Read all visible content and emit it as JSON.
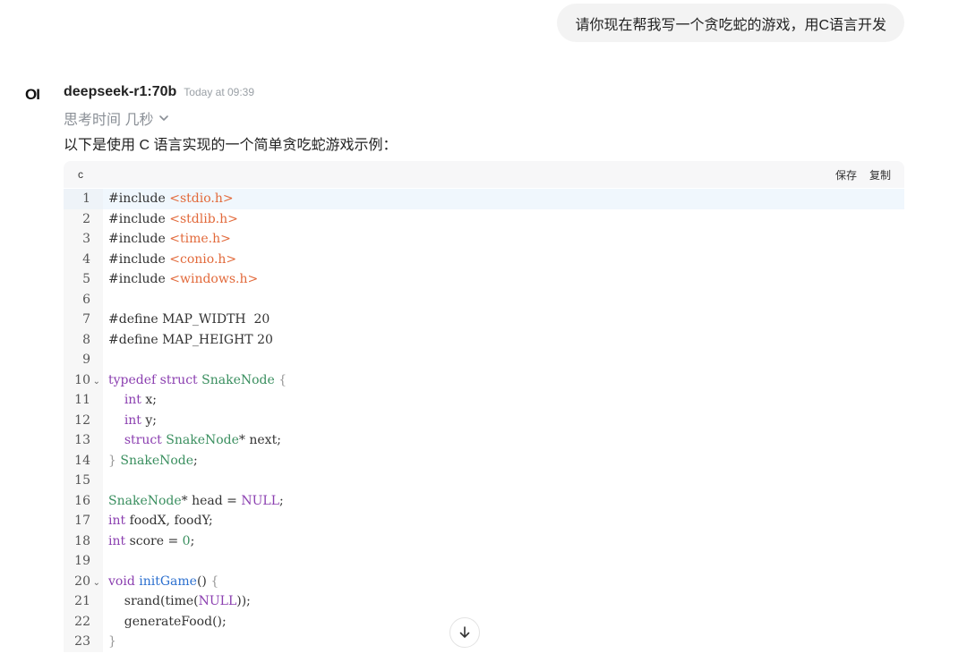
{
  "user_message": "请你现在帮我写一个贪吃蛇的游戏，用C语言开发",
  "assistant": {
    "avatar_text": "OI",
    "model": "deepseek-r1:70b",
    "timestamp": "Today at 09:39",
    "thinking_label": "思考时间 几秒",
    "intro": "以下是使用 C 语言实现的一个简单贪吃蛇游戏示例："
  },
  "code_block": {
    "language": "c",
    "save_label": "保存",
    "copy_label": "复制",
    "lines": [
      {
        "n": "1",
        "text": "#include <stdio.h>"
      },
      {
        "n": "2",
        "text": "#include <stdlib.h>"
      },
      {
        "n": "3",
        "text": "#include <time.h>"
      },
      {
        "n": "4",
        "text": "#include <conio.h>"
      },
      {
        "n": "5",
        "text": "#include <windows.h>"
      },
      {
        "n": "6",
        "text": ""
      },
      {
        "n": "7",
        "text": "#define MAP_WIDTH  20"
      },
      {
        "n": "8",
        "text": "#define MAP_HEIGHT 20"
      },
      {
        "n": "9",
        "text": ""
      },
      {
        "n": "10",
        "text": "typedef struct SnakeNode {"
      },
      {
        "n": "11",
        "text": "    int x;"
      },
      {
        "n": "12",
        "text": "    int y;"
      },
      {
        "n": "13",
        "text": "    struct SnakeNode* next;"
      },
      {
        "n": "14",
        "text": "} SnakeNode;"
      },
      {
        "n": "15",
        "text": ""
      },
      {
        "n": "16",
        "text": "SnakeNode* head = NULL;"
      },
      {
        "n": "17",
        "text": "int foodX, foodY;"
      },
      {
        "n": "18",
        "text": "int score = 0;"
      },
      {
        "n": "19",
        "text": ""
      },
      {
        "n": "20",
        "text": "void initGame() {"
      },
      {
        "n": "21",
        "text": "    srand(time(NULL));"
      },
      {
        "n": "22",
        "text": "    generateFood();"
      },
      {
        "n": "23",
        "text": "}"
      }
    ]
  },
  "colors": {
    "string": "#e2693a",
    "keyword": "#8b3fb0",
    "type": "#3a8f5f",
    "function": "#2b6fcf"
  },
  "icons": {
    "thinking_toggle": "chevron-down-icon",
    "scroll_down": "arrow-down-icon",
    "fold_marker": "fold-chevron-icon"
  }
}
